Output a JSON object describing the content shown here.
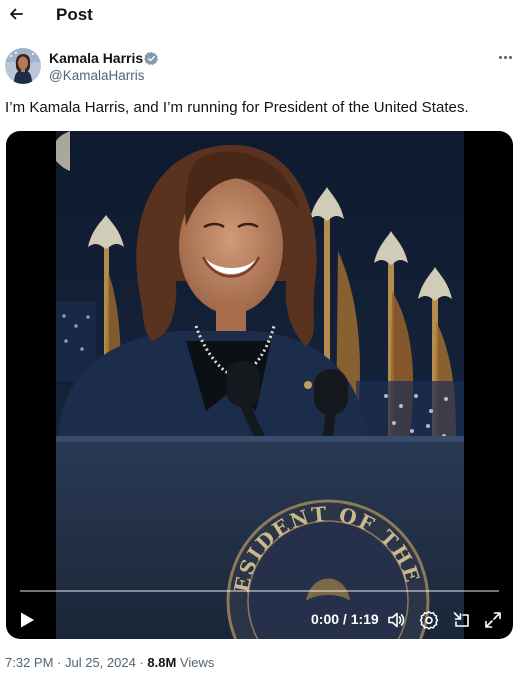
{
  "header": {
    "title": "Post"
  },
  "author": {
    "name": "Kamala Harris",
    "handle": "@KamalaHarris"
  },
  "tweet": {
    "text": "I’m Kamala Harris, and I’m running for President of the United States."
  },
  "video": {
    "time": "0:00 / 1:19",
    "progress": 0,
    "seal_text": "ESIDENT OF THE UNITE"
  },
  "meta": {
    "time": "7:32 PM",
    "date": "Jul 25, 2024",
    "sep": " · ",
    "views_count": "8.8M",
    "views_label": "Views"
  },
  "colors": {
    "text": "#0f1419",
    "secondary": "#536471",
    "verified_badge": "#829aab",
    "background": "#ffffff"
  },
  "icons": [
    "back-arrow-icon",
    "verified-badge-icon",
    "more-icon",
    "play-icon",
    "volume-icon",
    "settings-icon",
    "minimize-icon",
    "fullscreen-icon"
  ]
}
